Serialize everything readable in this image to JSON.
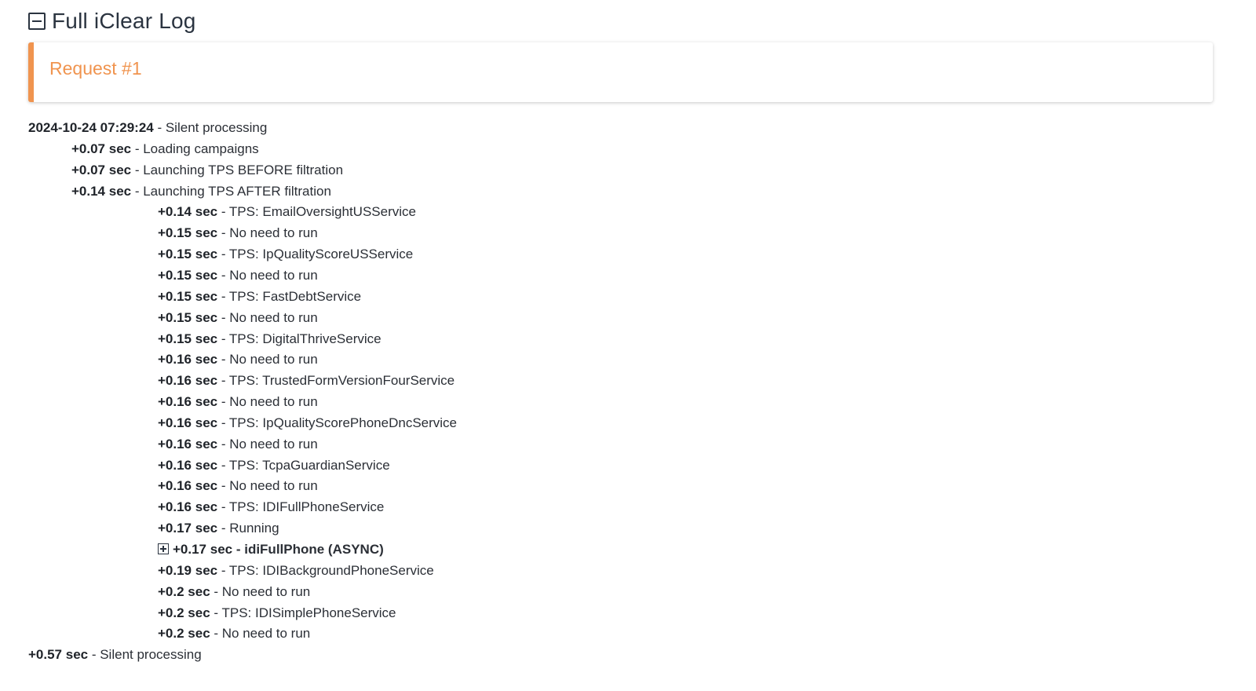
{
  "header": {
    "title": "Full iClear Log",
    "toggle_icon": "collapse-minus-icon"
  },
  "request_card": {
    "title": "Request #1",
    "accent_color": "#f0944f"
  },
  "log": [
    {
      "level": 0,
      "ts": "2024-10-24 07:29:24",
      "sep": " - ",
      "msg": "Silent processing"
    },
    {
      "level": 1,
      "ts": "+0.07 sec",
      "sep": " - ",
      "msg": "Loading campaigns"
    },
    {
      "level": 1,
      "ts": "+0.07 sec",
      "sep": " - ",
      "msg": "Launching TPS BEFORE filtration"
    },
    {
      "level": 1,
      "ts": "+0.14 sec",
      "sep": " - ",
      "msg": "Launching TPS AFTER filtration"
    },
    {
      "level": 2,
      "ts": "+0.14 sec",
      "sep": " - ",
      "msg": "TPS: EmailOversightUSService"
    },
    {
      "level": 2,
      "ts": "+0.15 sec",
      "sep": " - ",
      "msg": "No need to run"
    },
    {
      "level": 2,
      "ts": "+0.15 sec",
      "sep": " - ",
      "msg": "TPS: IpQualityScoreUSService"
    },
    {
      "level": 2,
      "ts": "+0.15 sec",
      "sep": " - ",
      "msg": "No need to run"
    },
    {
      "level": 2,
      "ts": "+0.15 sec",
      "sep": " - ",
      "msg": "TPS: FastDebtService"
    },
    {
      "level": 2,
      "ts": "+0.15 sec",
      "sep": " - ",
      "msg": "No need to run"
    },
    {
      "level": 2,
      "ts": "+0.15 sec",
      "sep": " - ",
      "msg": "TPS: DigitalThriveService"
    },
    {
      "level": 2,
      "ts": "+0.16 sec",
      "sep": " - ",
      "msg": "No need to run"
    },
    {
      "level": 2,
      "ts": "+0.16 sec",
      "sep": " - ",
      "msg": "TPS: TrustedFormVersionFourService"
    },
    {
      "level": 2,
      "ts": "+0.16 sec",
      "sep": " - ",
      "msg": "No need to run"
    },
    {
      "level": 2,
      "ts": "+0.16 sec",
      "sep": " - ",
      "msg": "TPS: IpQualityScorePhoneDncService"
    },
    {
      "level": 2,
      "ts": "+0.16 sec",
      "sep": " - ",
      "msg": "No need to run"
    },
    {
      "level": 2,
      "ts": "+0.16 sec",
      "sep": " - ",
      "msg": "TPS: TcpaGuardianService"
    },
    {
      "level": 2,
      "ts": "+0.16 sec",
      "sep": " - ",
      "msg": "No need to run"
    },
    {
      "level": 2,
      "ts": "+0.16 sec",
      "sep": " - ",
      "msg": "TPS: IDIFullPhoneService"
    },
    {
      "level": 2,
      "ts": "+0.17 sec",
      "sep": " - ",
      "msg": "Running"
    },
    {
      "level": 2,
      "ts": "+0.17 sec",
      "sep": " - ",
      "msg": "idiFullPhone (ASYNC)",
      "expandable": true
    },
    {
      "level": 2,
      "ts": "+0.19 sec",
      "sep": " - ",
      "msg": "TPS: IDIBackgroundPhoneService"
    },
    {
      "level": 2,
      "ts": "+0.2 sec",
      "sep": " - ",
      "msg": "No need to run"
    },
    {
      "level": 2,
      "ts": "+0.2 sec",
      "sep": " - ",
      "msg": "TPS: IDISimplePhoneService"
    },
    {
      "level": 2,
      "ts": "+0.2 sec",
      "sep": " - ",
      "msg": "No need to run"
    },
    {
      "level": 0,
      "ts": "+0.57 sec",
      "sep": " - ",
      "msg": "Silent processing"
    }
  ]
}
